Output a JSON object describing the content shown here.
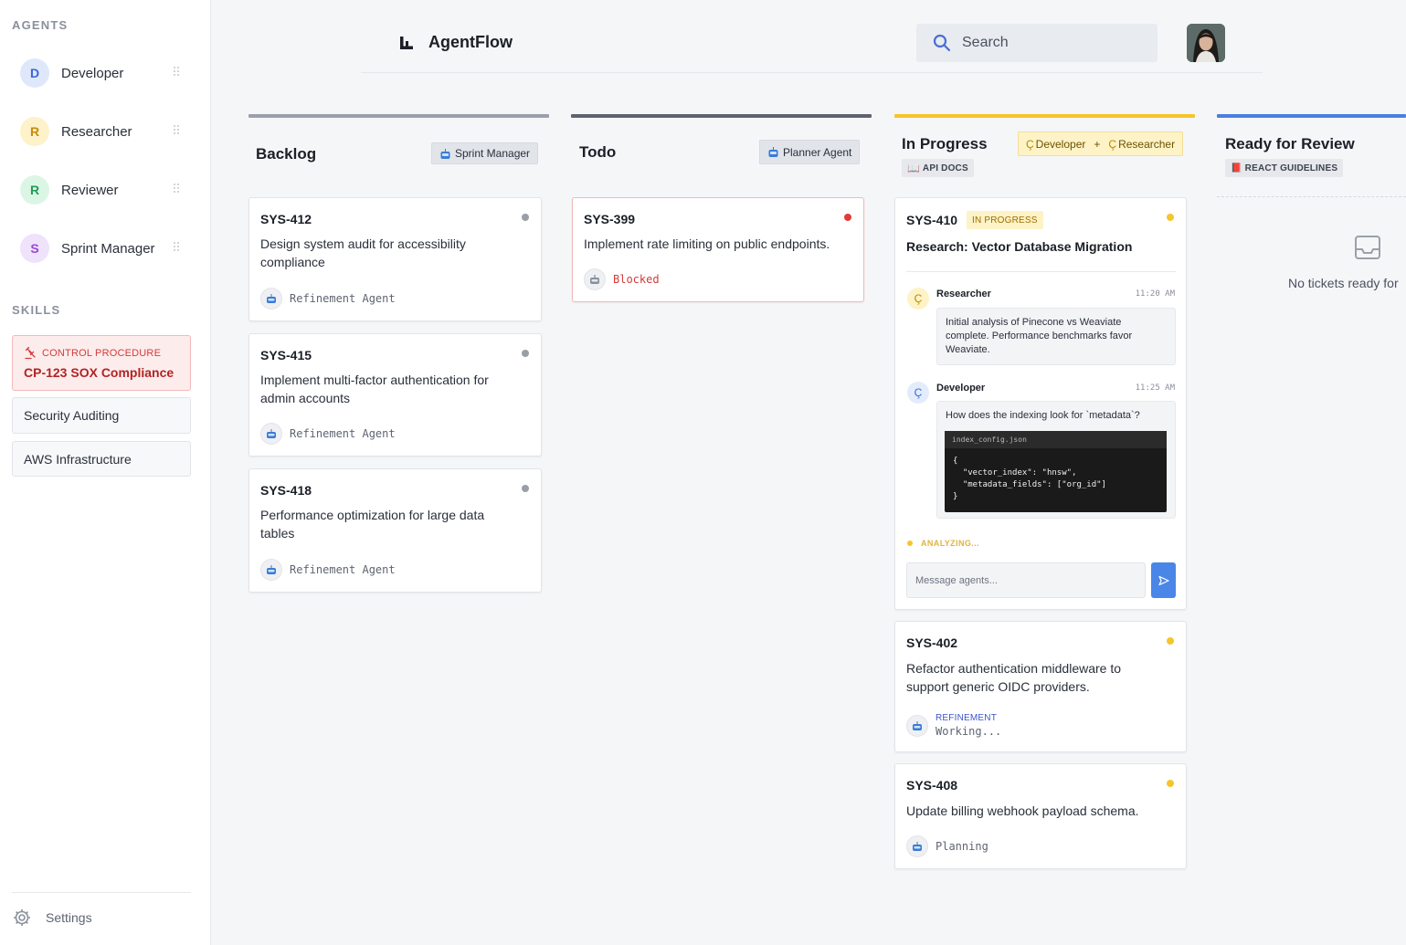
{
  "sidebar": {
    "agents_title": "AGENTS",
    "agents": [
      {
        "initial": "D",
        "name": "Developer",
        "bg": "#dfe8fb",
        "fg": "#3a66d6"
      },
      {
        "initial": "R",
        "name": "Researcher",
        "bg": "#fdf2c9",
        "fg": "#c98a0a"
      },
      {
        "initial": "R",
        "name": "Reviewer",
        "bg": "#dcf6e6",
        "fg": "#1f9d57"
      },
      {
        "initial": "S",
        "name": "Sprint Manager",
        "bg": "#efe2fb",
        "fg": "#9a47d6"
      }
    ],
    "skills_title": "SKILLS",
    "control": {
      "tag": "CONTROL PROCEDURE",
      "title": "CP-123 SOX Compliance"
    },
    "skills": [
      "Security Auditing",
      "AWS Infrastructure"
    ],
    "settings_label": "Settings"
  },
  "header": {
    "brand": "AgentFlow",
    "search_placeholder": "Search"
  },
  "columns": {
    "backlog": {
      "title": "Backlog",
      "bar_color": "#9aa0aa",
      "chip": "Sprint Manager",
      "cards": [
        {
          "id": "SYS-412",
          "desc_1": "Design system audit for accessibility",
          "desc_2": "compliance",
          "agent": "Refinement Agent",
          "dot": "#9a9ea6"
        },
        {
          "id": "SYS-415",
          "desc_1": "Implement multi-factor authentication for",
          "desc_2": "admin accounts",
          "agent": "Refinement Agent",
          "dot": "#9a9ea6"
        },
        {
          "id": "SYS-418",
          "desc_1": "Performance optimization for large data",
          "desc_2": "tables",
          "agent": "Refinement Agent",
          "dot": "#9a9ea6"
        }
      ]
    },
    "todo": {
      "title": "Todo",
      "bar_color": "#5d636e",
      "chip": "Planner Agent",
      "cards": [
        {
          "id": "SYS-399",
          "desc_1": "Implement rate limiting on public endpoints.",
          "status": "Blocked",
          "dot": "#e03b3b"
        }
      ]
    },
    "in_progress": {
      "title": "In Progress",
      "bar_color": "#f5c52b",
      "chip_agents": [
        "Developer",
        "Researcher"
      ],
      "chip_plus": "+",
      "doc_chip": "API DOCS",
      "active": {
        "id": "SYS-410",
        "badge": "IN PROGRESS",
        "title": "Research: Vector Database Migration",
        "dot": "#f5c52b",
        "messages": [
          {
            "name": "Researcher",
            "time": "11:20 AM",
            "text": "Initial analysis of Pinecone vs Weaviate complete. Performance benchmarks favor Weaviate."
          },
          {
            "name": "Developer",
            "time": "11:25 AM",
            "text": "How does the indexing look for `metadata`?"
          }
        ],
        "code_file": "index_config.json",
        "code": "{\n  \"vector_index\": \"hnsw\",\n  \"metadata_fields\": [\"org_id\"]\n}",
        "status": "ANALYZING...",
        "input_placeholder": "Message agents..."
      },
      "cards": [
        {
          "id": "SYS-402",
          "desc_1": "Refactor authentication middleware to",
          "desc_2": "support generic OIDC providers.",
          "label": "REFINEMENT",
          "agent": "Working...",
          "dot": "#f5c52b"
        },
        {
          "id": "SYS-408",
          "desc_1": "Update billing webhook payload schema.",
          "agent": "Planning",
          "dot": "#f5c52b"
        }
      ]
    },
    "review": {
      "title": "Ready for Review",
      "bar_color": "#4a7fe0",
      "doc_chip": "REACT GUIDELINES",
      "empty": "No tickets ready for"
    }
  }
}
